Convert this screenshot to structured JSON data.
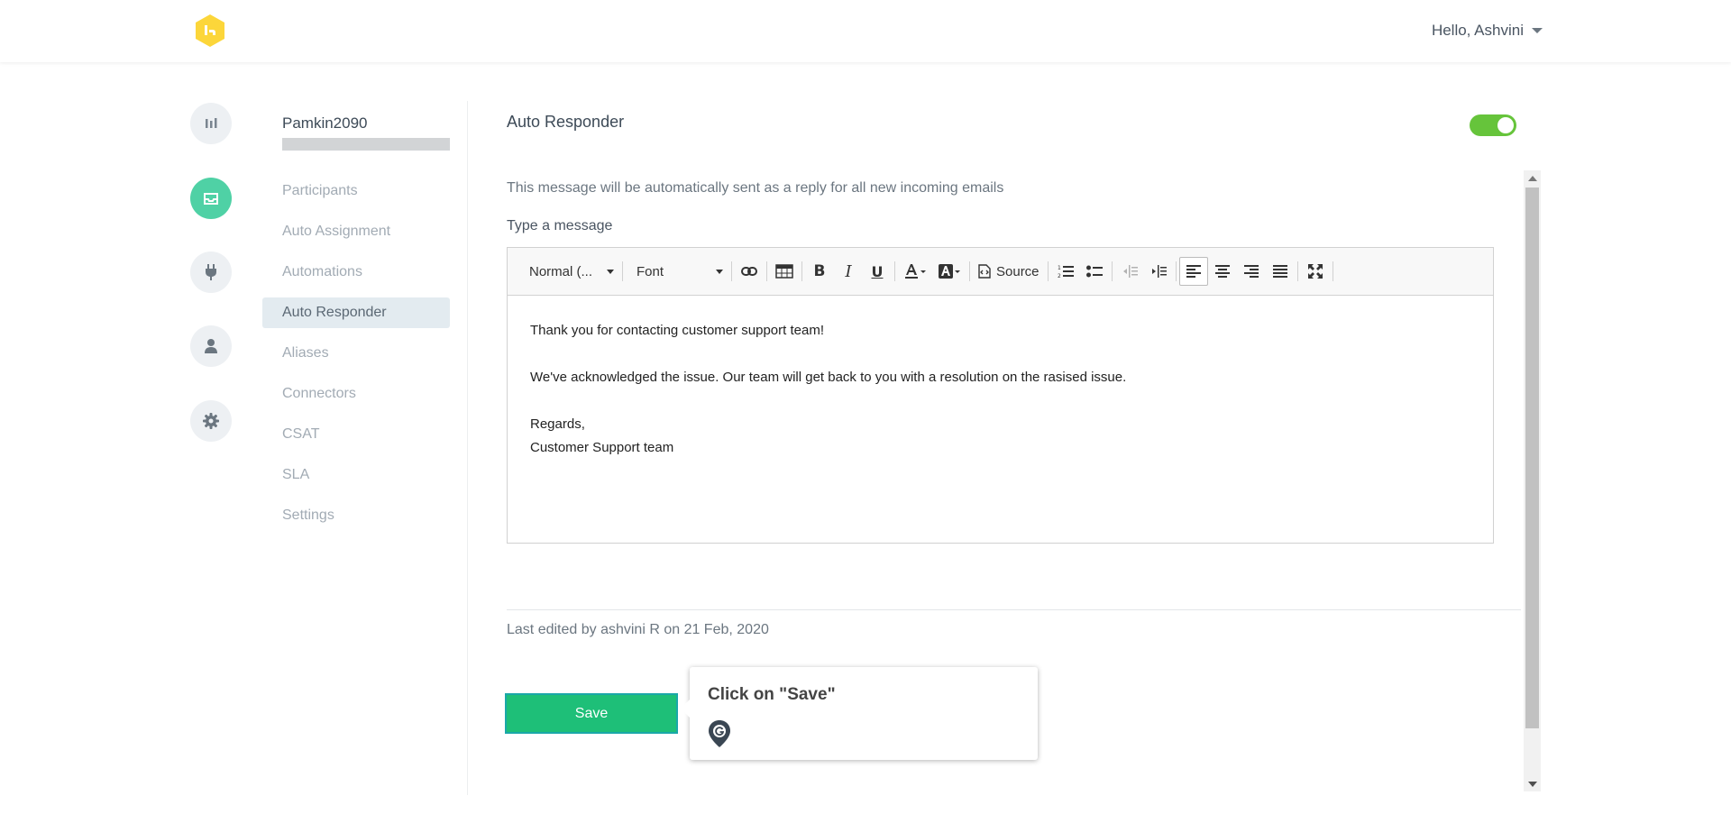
{
  "header": {
    "greeting": "Hello, Ashvini",
    "brand_color": "#fcd63a"
  },
  "rail": {
    "items": [
      {
        "name": "reports-icon",
        "active": false
      },
      {
        "name": "inbox-icon",
        "active": true
      },
      {
        "name": "plug-icon",
        "active": false
      },
      {
        "name": "user-icon",
        "active": false
      },
      {
        "name": "gear-icon",
        "active": false
      }
    ],
    "active_color": "#4fd1a5"
  },
  "subnav": {
    "account_name": "Pamkin2090",
    "items": [
      {
        "label": "Participants"
      },
      {
        "label": "Auto Assignment"
      },
      {
        "label": "Automations"
      },
      {
        "label": "Auto Responder",
        "active": true
      },
      {
        "label": "Aliases"
      },
      {
        "label": "Connectors"
      },
      {
        "label": "CSAT"
      },
      {
        "label": "SLA"
      },
      {
        "label": "Settings"
      }
    ]
  },
  "main": {
    "title": "Auto Responder",
    "toggle_on": true,
    "toggle_color": "#66c43b",
    "description": "This message will be automatically sent as a reply for all new incoming emails",
    "message_label": "Type a message",
    "toolbar": {
      "format_label": "Normal (...",
      "font_label": "Font",
      "source_label": "Source"
    },
    "message_lines": [
      "Thank you for contacting customer support team!",
      "",
      "We've acknowledged the issue. Our team will get back to you with a resolution on the rasised issue.",
      "",
      "Regards,",
      "Customer Support team"
    ],
    "last_edited": "Last edited by  ashvini R on 21 Feb, 2020",
    "save_label": "Save",
    "save_color": "#1ebf78"
  },
  "tooltip": {
    "text": "Click on \"Save\""
  }
}
